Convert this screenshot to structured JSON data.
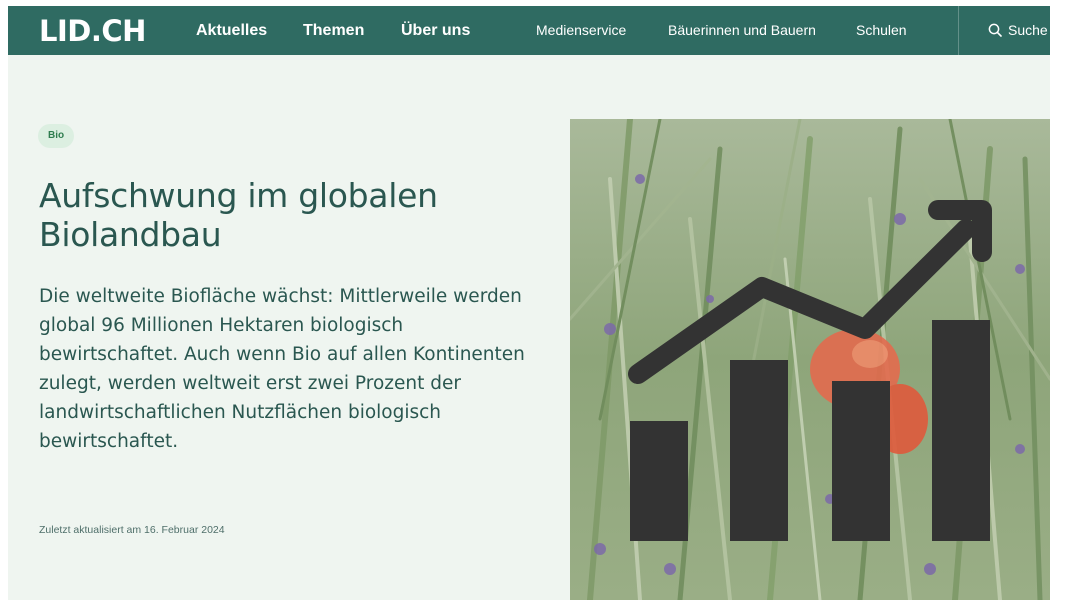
{
  "header": {
    "logo": "LID.CH",
    "nav_primary": [
      "Aktuelles",
      "Themen",
      "Über uns"
    ],
    "nav_secondary": [
      "Medienservice",
      "Bäuerinnen und Bauern",
      "Schulen"
    ],
    "search_label": "Suche"
  },
  "article": {
    "tag": "Bio",
    "title": "Aufschwung im globalen Biolandbau",
    "lead": "Die weltweite Biofläche wächst: Mittlerweile werden global 96 Millionen Hektaren biologisch bewirtschaftet. Auch wenn Bio auf allen Kontinenten zulegt, werden weltweit erst zwei Prozent der landwirtschaftlichen Nutzflächen biologisch bewirtschaftet.",
    "updated": "Zuletzt aktualisiert am 16. Februar 2024"
  },
  "colors": {
    "nav_bg": "#2f6b62",
    "page_bg": "#eff5f0",
    "text": "#2a5750",
    "tag_bg": "#dcefe1",
    "tag_text": "#2f7d4f",
    "chart_icon": "#333333"
  },
  "hero_image": {
    "icon": "bar-chart-growth-icon",
    "scene": "grass-field-with-poppy"
  }
}
